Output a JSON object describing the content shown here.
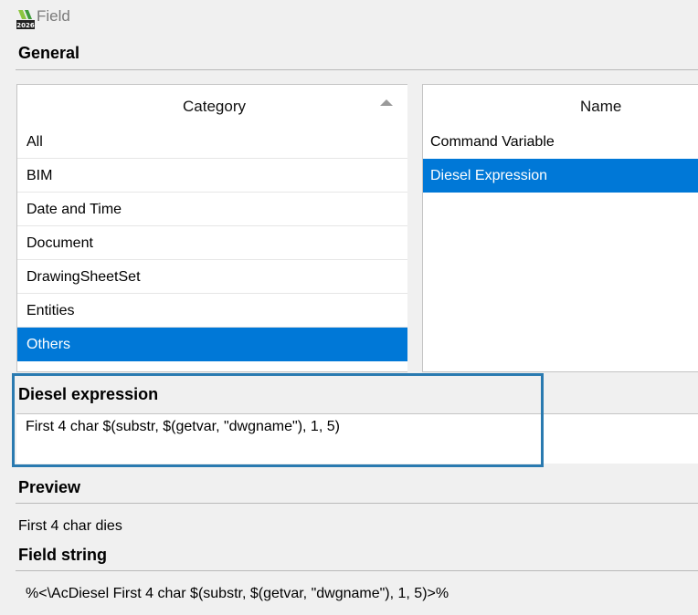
{
  "window": {
    "title": "Field",
    "icon": "autocad-2026-icon",
    "icon_badge": "2026"
  },
  "general": {
    "heading": "General"
  },
  "category": {
    "header": "Category",
    "items": [
      "All",
      "BIM",
      "Date and Time",
      "Document",
      "DrawingSheetSet",
      "Entities",
      "Others"
    ],
    "selected": "Others"
  },
  "name": {
    "header": "Name",
    "items": [
      "Command Variable",
      "Diesel Expression"
    ],
    "selected": "Diesel Expression"
  },
  "diesel": {
    "heading": "Diesel expression",
    "value": "First 4 char $(substr, $(getvar, \"dwgname\"), 1, 5)"
  },
  "preview": {
    "heading": "Preview",
    "value": "First 4 char  dies"
  },
  "field_string": {
    "heading": "Field string",
    "value": "%<\\AcDiesel First 4 char $(substr, $(getvar, \"dwgname\"), 1, 5)>%"
  },
  "colors": {
    "selection": "#0078d7",
    "highlight_outline": "#2a7ab0"
  }
}
